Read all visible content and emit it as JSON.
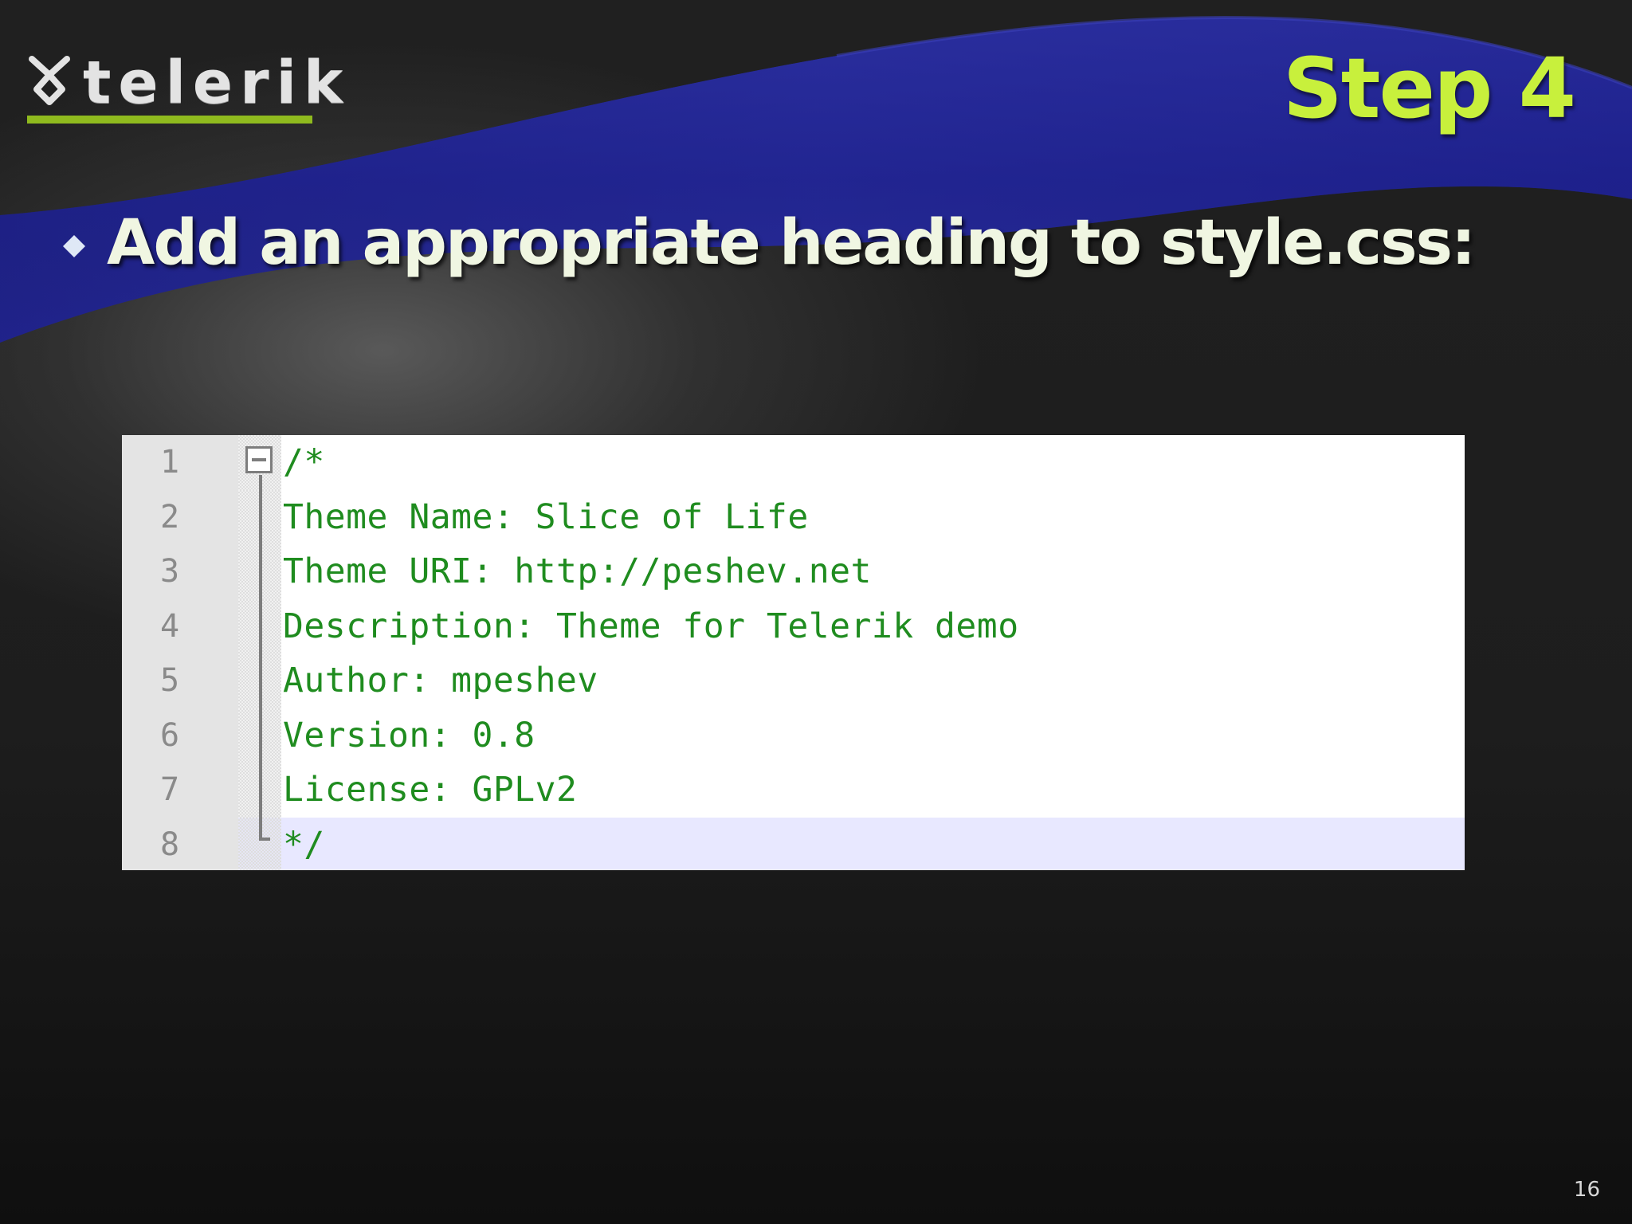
{
  "logo": {
    "text": "telerik",
    "mark_icon": "telerik-logo-mark-icon",
    "underline_color": "#8fba1e"
  },
  "header": {
    "title": "Step 4",
    "title_color": "#c8f03c"
  },
  "content": {
    "bullet_icon": "diamond-bullet-icon",
    "bullet_text": "Add an appropriate heading to style.css:"
  },
  "code_editor": {
    "text_color": "#1f8c1f",
    "current_line_color": "#e8e8ff",
    "fold_icon": "fold-collapse-icon",
    "lines": [
      {
        "number": "1",
        "text": "/*"
      },
      {
        "number": "2",
        "text": "Theme Name: Slice of Life"
      },
      {
        "number": "3",
        "text": "Theme URI: http://peshev.net"
      },
      {
        "number": "4",
        "text": "Description: Theme for Telerik demo"
      },
      {
        "number": "5",
        "text": "Author: mpeshev"
      },
      {
        "number": "6",
        "text": "Version: 0.8"
      },
      {
        "number": "7",
        "text": "License: GPLv2"
      },
      {
        "number": "8",
        "text": "*/"
      }
    ]
  },
  "footer": {
    "slide_number": "16"
  }
}
